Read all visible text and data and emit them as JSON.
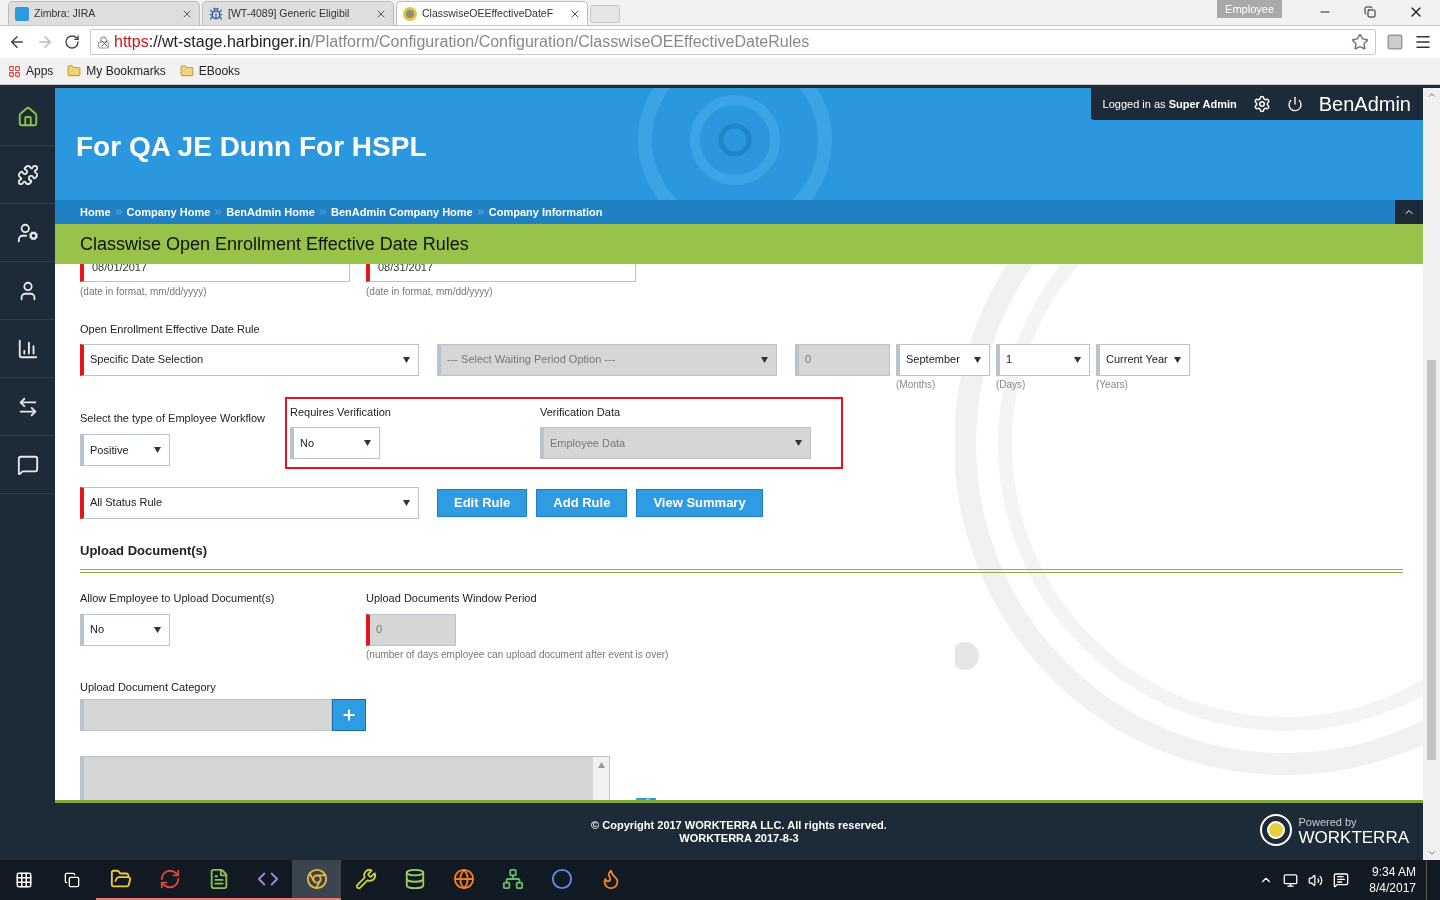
{
  "browser": {
    "tabs": [
      {
        "title": "Zimbra: JIRA",
        "kind": "zimbra",
        "selected": false
      },
      {
        "title": "[WT-4089] Generic Eligibil",
        "kind": "jira",
        "selected": false
      },
      {
        "title": "ClasswiseOEEffectiveDateF",
        "kind": "site",
        "selected": true
      }
    ],
    "profile": "Employee",
    "url": {
      "scheme": "https",
      "host": "://wt-stage.harbinger.in",
      "path": "/Platform/Configuration/Configuration/ClasswiseOEEffectiveDateRules",
      "insecure": true
    },
    "bookmarks": [
      {
        "label": "Apps",
        "kind": "apps"
      },
      {
        "label": "My Bookmarks",
        "kind": "folder"
      },
      {
        "label": "EBooks",
        "kind": "folder"
      }
    ]
  },
  "sidebar": [
    {
      "kind": "home",
      "selected": true
    },
    {
      "kind": "puzzle",
      "selected": false
    },
    {
      "kind": "user-gear",
      "selected": false
    },
    {
      "kind": "user",
      "selected": false
    },
    {
      "kind": "chart",
      "selected": false
    },
    {
      "kind": "transfer",
      "selected": false
    },
    {
      "kind": "chat",
      "selected": false
    }
  ],
  "header": {
    "company": "For QA JE Dunn For HSPL",
    "logged_in_prefix": "Logged in as",
    "user": "Super Admin",
    "app_name": "BenAdmin",
    "breadcrumbs": [
      "Home",
      "Company Home",
      "BenAdmin Home",
      "BenAdmin Company Home",
      "Company Information"
    ],
    "page_title": "Classwise Open Enrollment Effective Date Rules"
  },
  "form": {
    "dates": [
      {
        "value": "08/01/2017",
        "hint": "(date in format, mm/dd/yyyy)",
        "required": true
      },
      {
        "value": "08/31/2017",
        "hint": "(date in format, mm/dd/yyyy)",
        "required": true
      }
    ],
    "rule_label": "Open Enrollment Effective Date Rule",
    "rule_fields": [
      {
        "kind": "select",
        "value": "Specific Date Selection",
        "required": true,
        "disabled": false
      },
      {
        "kind": "select",
        "value": "--- Select Waiting Period Option ---",
        "required": false,
        "disabled": true
      },
      {
        "kind": "input",
        "value": "0",
        "required": false,
        "disabled": true
      },
      {
        "kind": "select",
        "value": "September",
        "unit": "(Months)",
        "required": false,
        "disabled": false
      },
      {
        "kind": "select",
        "value": "1",
        "unit": "(Days)",
        "required": false,
        "disabled": false
      },
      {
        "kind": "select",
        "value": "Current Year",
        "unit": "(Years)",
        "required": false,
        "disabled": false
      }
    ],
    "workflow": {
      "label": "Select the type of Employee Workflow",
      "value": "Positive"
    },
    "verification": {
      "highlighted": true,
      "requires": {
        "label": "Requires Verification",
        "value": "No",
        "disabled": false
      },
      "data": {
        "label": "Verification Data",
        "value": "Employee Data",
        "disabled": true
      }
    },
    "status_rule": {
      "value": "All Status Rule",
      "required": true
    },
    "buttons": [
      "Edit Rule",
      "Add Rule",
      "View Summary"
    ],
    "upload": {
      "title": "Upload Document(s)",
      "allow": {
        "label": "Allow Employee to Upload Document(s)",
        "value": "No"
      },
      "window_period": {
        "label": "Upload Documents Window Period",
        "value": "0",
        "hint": "(number of days employee can upload document after event is over)",
        "required": true,
        "disabled": true
      },
      "category": {
        "label": "Upload Document Category",
        "disabled": true
      },
      "list": {
        "disabled": true
      }
    }
  },
  "footer": {
    "copyright": "© Copyright 2017 WORKTERRA LLC. All rights reserved.",
    "version": "WORKTERRA 2017-8-3",
    "powered_by": "Powered by",
    "brand": "WORKTERRA"
  },
  "taskbar": {
    "apps": [
      {
        "kind": "explorer",
        "active": false,
        "running": true
      },
      {
        "kind": "sync",
        "active": false,
        "running": true
      },
      {
        "kind": "notepad",
        "active": false,
        "running": true
      },
      {
        "kind": "studio",
        "active": false,
        "running": true
      },
      {
        "kind": "chrome",
        "active": true,
        "running": true
      },
      {
        "kind": "tools",
        "active": false,
        "running": false
      },
      {
        "kind": "database",
        "active": false,
        "running": false
      },
      {
        "kind": "firefox",
        "active": false,
        "running": false
      },
      {
        "kind": "network",
        "active": false,
        "running": false
      },
      {
        "kind": "cycle",
        "active": false,
        "running": false
      },
      {
        "kind": "flame",
        "active": false,
        "running": false
      }
    ],
    "time": "9:34 AM",
    "date": "8/4/2017"
  }
}
